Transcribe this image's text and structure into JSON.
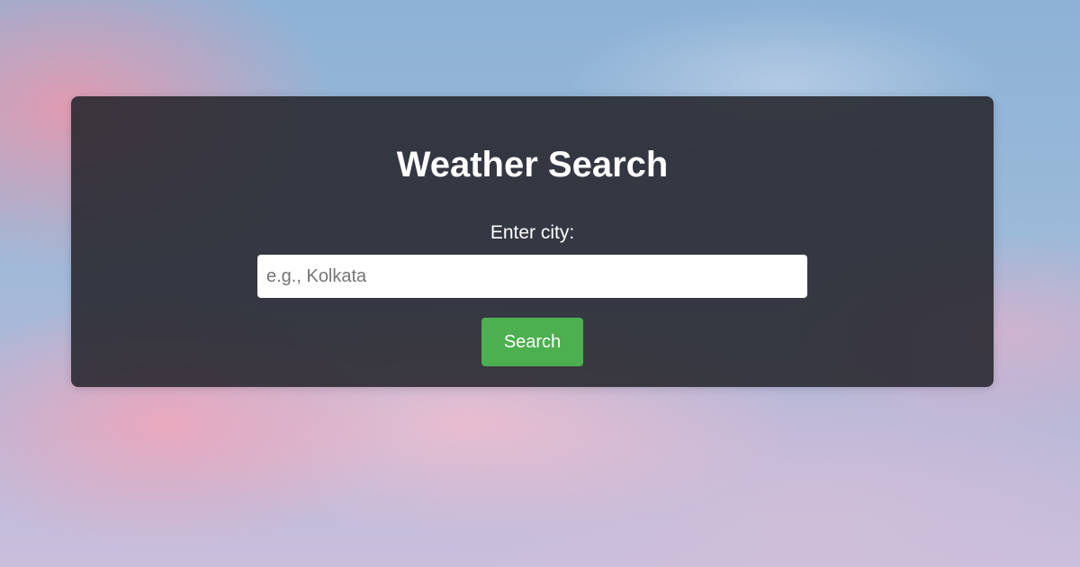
{
  "card": {
    "title": "Weather Search",
    "label": "Enter city:",
    "input": {
      "value": "",
      "placeholder": "e.g., Kolkata"
    },
    "search_label": "Search"
  },
  "colors": {
    "card_background": "#26262c",
    "button": "#4caf50",
    "text": "#ffffff"
  }
}
